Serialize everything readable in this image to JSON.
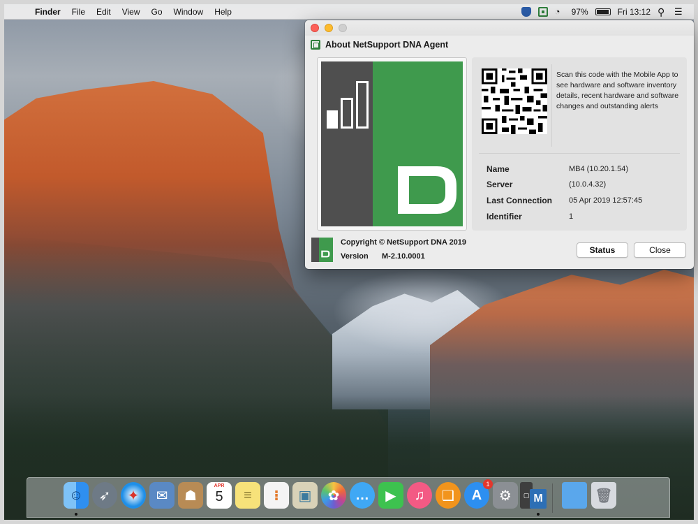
{
  "menubar": {
    "app_name": "Finder",
    "items": [
      "File",
      "Edit",
      "View",
      "Go",
      "Window",
      "Help"
    ],
    "battery": "97%",
    "clock": "Fri 13:12"
  },
  "window": {
    "title": "About NetSupport DNA Agent",
    "qr_description": "Scan this code with the Mobile App to see hardware and software inventory details, recent hardware and software changes and outstanding alerts",
    "fields": [
      {
        "label": "Name",
        "value": "MB4 (10.20.1.54)"
      },
      {
        "label": "Server",
        "value": "(10.0.4.32)"
      },
      {
        "label": "Last Connection",
        "value": "05 Apr 2019 12:57:45"
      },
      {
        "label": "Identifier",
        "value": "1"
      }
    ],
    "copyright": "Copyright © NetSupport DNA 2019",
    "version_label": "Version",
    "version_value": "M-2.10.0001",
    "status_button": "Status",
    "close_button": "Close"
  },
  "dock": {
    "apps": [
      {
        "name": "Finder",
        "icon": "finder-icon",
        "color": "#2f8ff0"
      },
      {
        "name": "Launchpad",
        "icon": "rocket-icon",
        "color": "#6e7a86"
      },
      {
        "name": "Safari",
        "icon": "compass-icon",
        "color": "#1f8fe8"
      },
      {
        "name": "Mail",
        "icon": "stamp-icon",
        "color": "#5a89c4"
      },
      {
        "name": "Contacts",
        "icon": "contacts-icon",
        "color": "#b88b55"
      },
      {
        "name": "Calendar",
        "icon": "calendar-icon",
        "color": "#ffffff",
        "month": "APR",
        "day": "5"
      },
      {
        "name": "Notes",
        "icon": "notes-icon",
        "color": "#f7e27a"
      },
      {
        "name": "Reminders",
        "icon": "reminders-icon",
        "color": "#f4f4f4"
      },
      {
        "name": "Preview",
        "icon": "preview-icon",
        "color": "#d9d2b8"
      },
      {
        "name": "Photos",
        "icon": "photos-icon",
        "color": "#fafafa"
      },
      {
        "name": "Messages",
        "icon": "messages-icon",
        "color": "#3fa8f5"
      },
      {
        "name": "FaceTime",
        "icon": "facetime-icon",
        "color": "#3dc24f"
      },
      {
        "name": "iTunes",
        "icon": "music-icon",
        "color": "#f35a84"
      },
      {
        "name": "iBooks",
        "icon": "books-icon",
        "color": "#f2941c"
      },
      {
        "name": "App Store",
        "icon": "appstore-icon",
        "color": "#2d8ff0",
        "badge": "1"
      },
      {
        "name": "System Preferences",
        "icon": "gear-icon",
        "color": "#8b8f94"
      },
      {
        "name": "NetSupport DNA",
        "icon": "dna-app-icon",
        "color": "#3e3e3e"
      },
      {
        "name": "NetSupport Manager",
        "icon": "manager-app-icon",
        "color": "#2d6fb5"
      },
      {
        "name": "Downloads",
        "icon": "folder-icon",
        "color": "#5aa7ec"
      },
      {
        "name": "Trash",
        "icon": "trash-icon",
        "color": "#d7dadf"
      }
    ]
  },
  "colors": {
    "dna_green": "#3f9a4d",
    "dna_dark": "#4f4f4f"
  }
}
